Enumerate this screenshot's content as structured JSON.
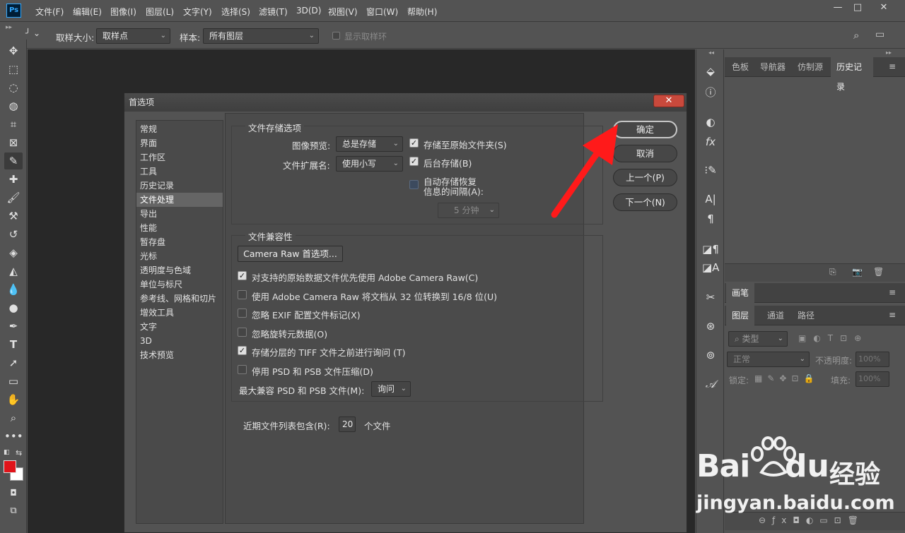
{
  "app": {
    "logo": "Ps"
  },
  "menu": [
    "文件(F)",
    "编辑(E)",
    "图像(I)",
    "图层(L)",
    "文字(Y)",
    "选择(S)",
    "滤镜(T)",
    "3D(D)",
    "视图(V)",
    "窗口(W)",
    "帮助(H)"
  ],
  "window_controls": {
    "minimize": "—",
    "maximize": "□",
    "close": "✕"
  },
  "options_bar": {
    "sample_size_label": "取样大小:",
    "sample_size_value": "取样点",
    "sample_label": "样本:",
    "sample_value": "所有图层",
    "show_ring_label": "显示取样环"
  },
  "right_panels": {
    "top_tabs": [
      "色板",
      "导航器",
      "仿制源",
      "历史记录"
    ],
    "brush_tab": "画笔",
    "layer_tabs": [
      "图层",
      "通道",
      "路径"
    ],
    "filter_placeholder": "类型",
    "blend_mode": "正常",
    "opacity_label": "不透明度:",
    "opacity_value": "100%",
    "lock_label": "锁定:",
    "fill_label": "填充:",
    "fill_value": "100%"
  },
  "dialog": {
    "title": "首选项",
    "close": "✕",
    "nav": [
      "常规",
      "界面",
      "工作区",
      "工具",
      "历史记录",
      "文件处理",
      "导出",
      "性能",
      "暂存盘",
      "光标",
      "透明度与色域",
      "单位与标尺",
      "参考线、网格和切片",
      "增效工具",
      "文字",
      "3D",
      "技术预览"
    ],
    "nav_selected": 5,
    "file_saving": {
      "legend": "文件存储选项",
      "image_preview_label": "图像预览:",
      "image_preview_value": "总是存储",
      "ext_label": "文件扩展名:",
      "ext_value": "使用小写",
      "save_original_folder": "存储至原始文件夹(S)",
      "background_save": "后台存储(B)",
      "auto_recover_line1": "自动存储恢复",
      "auto_recover_line2": "信息的间隔(A):",
      "interval_value": "5 分钟"
    },
    "compat": {
      "legend": "文件兼容性",
      "camera_raw_button": "Camera Raw 首选项...",
      "options": [
        {
          "label": "对支持的原始数据文件优先使用 Adobe Camera Raw(C)",
          "checked": true
        },
        {
          "label": "使用 Adobe Camera Raw 将文档从 32 位转换到 16/8 位(U)",
          "checked": false
        },
        {
          "label": "忽略 EXIF 配置文件标记(X)",
          "checked": false
        },
        {
          "label": "忽略旋转元数据(O)",
          "checked": false
        },
        {
          "label": "存储分层的 TIFF 文件之前进行询问 (T)",
          "checked": true
        },
        {
          "label": "停用 PSD 和 PSB 文件压缩(D)",
          "checked": false
        }
      ],
      "max_compat_label": "最大兼容 PSD 和 PSB 文件(M):",
      "max_compat_value": "询问"
    },
    "recent_files_label": "近期文件列表包含(R):",
    "recent_files_value": "20",
    "recent_files_suffix": "个文件",
    "buttons": {
      "ok": "确定",
      "cancel": "取消",
      "prev": "上一个(P)",
      "next": "下一个(N)"
    }
  },
  "watermark": {
    "brand": "Bai",
    "brand2": "du",
    "cn": "经验",
    "url": "jingyan.baidu.com"
  },
  "colors": {
    "foreground": "#e0141a",
    "background": "#ffffff",
    "arrow": "#ff1a1a"
  }
}
